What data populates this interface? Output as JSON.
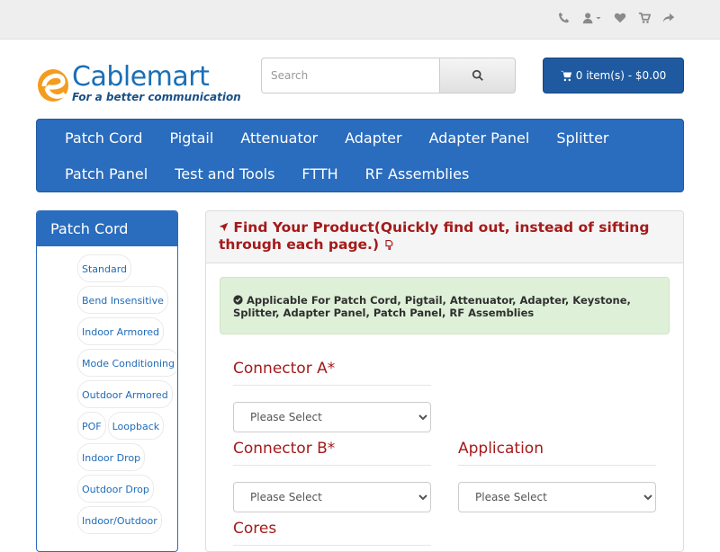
{
  "topbar": {
    "icons": [
      "phone-icon",
      "user-icon",
      "heart-icon",
      "cart-icon",
      "share-icon"
    ]
  },
  "logo": {
    "brand": "Cablemart",
    "tagline": "For a better communication"
  },
  "search": {
    "placeholder": "Search"
  },
  "cart": {
    "label": "0 item(s) - $0.00"
  },
  "menu": {
    "row1": [
      "Patch Cord",
      "Pigtail",
      "Attenuator",
      "Adapter",
      "Adapter Panel",
      "Splitter"
    ],
    "row2": [
      "Patch Panel",
      "Test and Tools",
      "FTTH",
      "RF Assemblies"
    ]
  },
  "sidebar": {
    "title": "Patch Cord",
    "items": [
      "Standard",
      "Bend Insensitive",
      "Indoor Armored",
      "Mode Conditioning",
      "Outdoor Armored",
      "POF",
      "Loopback",
      "Indoor Drop",
      "Outdoor Drop",
      "Indoor/Outdoor"
    ]
  },
  "finder": {
    "heading": "Find Your Product(Quickly find out, instead of sifting through each page.)",
    "applicable": "Applicable For Patch Cord, Pigtail, Attenuator, Adapter, Keystone, Splitter, Adapter Panel, Patch Panel, RF Assemblies",
    "connector_a_label": "Connector A*",
    "connector_b_label": "Connector B*",
    "application_label": "Application",
    "cores_label": "Cores",
    "select_placeholder": "Please Select"
  },
  "colors": {
    "primary": "#2a6cbd",
    "dark_primary": "#1f5aa0",
    "heading_red": "#a51a1a",
    "alert_green": "#dff0d8"
  }
}
